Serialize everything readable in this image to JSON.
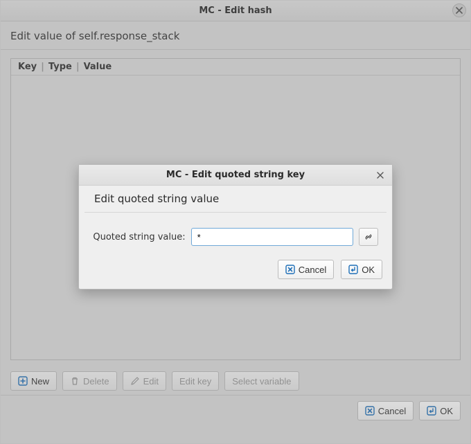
{
  "window": {
    "title": "MC - Edit hash"
  },
  "subtitle": "Edit value of self.response_stack",
  "table": {
    "columns": {
      "key": "Key",
      "type": "Type",
      "value": "Value"
    }
  },
  "toolbar": {
    "new_label": "New",
    "delete_label": "Delete",
    "edit_label": "Edit",
    "edit_key_label": "Edit key",
    "select_variable_label": "Select variable"
  },
  "footer": {
    "cancel_label": "Cancel",
    "ok_label": "OK"
  },
  "modal": {
    "title": "MC - Edit quoted string key",
    "subtitle": "Edit quoted string value",
    "field_label": "Quoted string value:",
    "value": "*",
    "cancel_label": "Cancel",
    "ok_label": "OK"
  }
}
